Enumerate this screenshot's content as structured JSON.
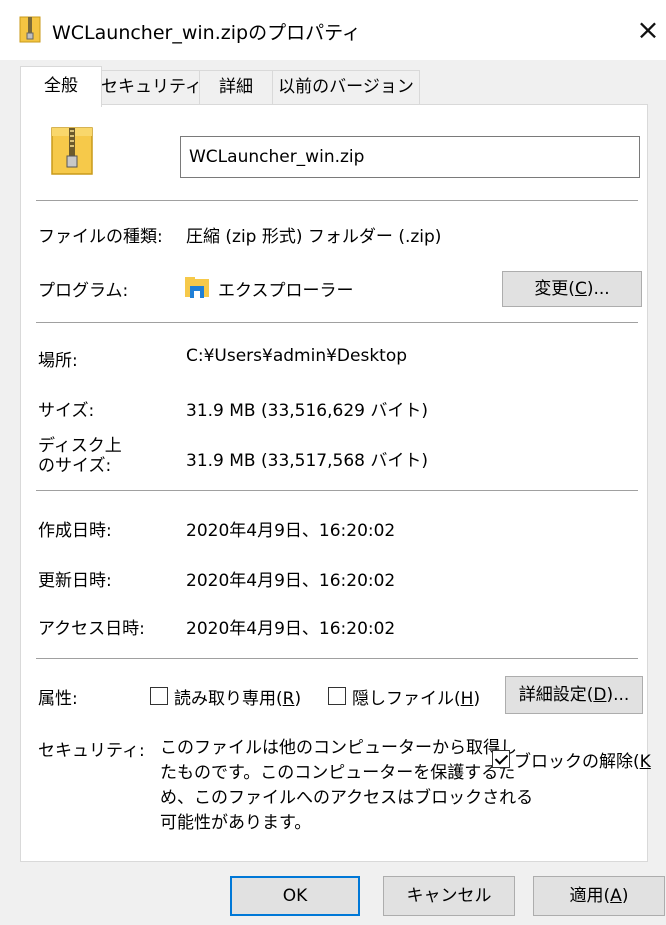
{
  "window": {
    "title": "WCLauncher_win.zipのプロパティ",
    "close": "×"
  },
  "tabs": [
    {
      "label": "全般"
    },
    {
      "label": "セキュリティ"
    },
    {
      "label": "詳細"
    },
    {
      "label": "以前のバージョン"
    }
  ],
  "general": {
    "filename": "WCLauncher_win.zip",
    "file_type_label": "ファイルの種類:",
    "file_type_value": "圧縮 (zip 形式) フォルダー (.zip)",
    "program_label": "プログラム:",
    "program_value": "エクスプローラー",
    "change_button_pre": "変更(",
    "change_button_key": "C",
    "change_button_post": ")...",
    "location_label": "場所:",
    "location_value": "C:¥Users¥admin¥Desktop",
    "size_label": "サイズ:",
    "size_value": "31.9 MB (33,516,629 バイト)",
    "disk_size_label_1": "ディスク上",
    "disk_size_label_2": "のサイズ:",
    "disk_size_value": "31.9 MB (33,517,568 バイト)",
    "created_label": "作成日時:",
    "created_value": "2020年4月9日、16:20:02",
    "modified_label": "更新日時:",
    "modified_value": "2020年4月9日、16:20:02",
    "accessed_label": "アクセス日時:",
    "accessed_value": "2020年4月9日、16:20:02",
    "attributes_label": "属性:",
    "readonly_pre": "読み取り専用(",
    "readonly_key": "R",
    "readonly_post": ")",
    "readonly_checked": false,
    "hidden_pre": "隠しファイル(",
    "hidden_key": "H",
    "hidden_post": ")",
    "hidden_checked": false,
    "advanced_pre": "詳細設定(",
    "advanced_key": "D",
    "advanced_post": ")...",
    "security_label": "セキュリティ:",
    "security_text_1": "このファイルは他のコンピューターから取得し",
    "security_text_2": "たものです。このコンピューターを保護するた",
    "security_text_3": "め、このファイルへのアクセスはブロックされる",
    "security_text_4": "可能性があります。",
    "unblock_pre": "ブロックの解除(",
    "unblock_key": "K",
    "unblock_checked": true
  },
  "footer": {
    "ok": "OK",
    "cancel": "キャンセル",
    "apply_pre": "適用(",
    "apply_key": "A",
    "apply_post": ")"
  }
}
